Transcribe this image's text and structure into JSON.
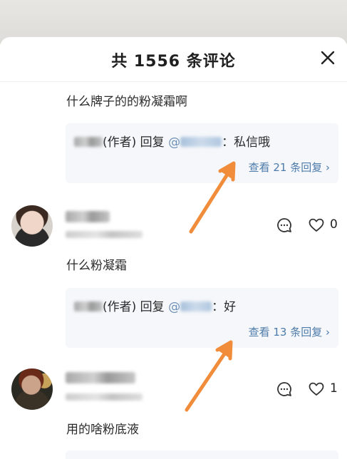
{
  "header": {
    "title": "共 1556 条评论"
  },
  "comments": [
    {
      "text": "什么牌子的的粉凝霜啊",
      "reply": {
        "tag": "(作者)",
        "verb": " 回复 ",
        "at": "@",
        "content": "：私信哦",
        "more": "查看 21 条回复 ›"
      }
    },
    {
      "likes": "0",
      "text": "什么粉凝霜",
      "reply": {
        "tag": "(作者)",
        "verb": " 回复 ",
        "at": "@",
        "content": "：好",
        "more": "查看 13 条回复 ›"
      }
    },
    {
      "likes": "1",
      "text": "用的啥粉底液"
    }
  ],
  "icons": {
    "close": "close-icon",
    "comment": "comment-bubble-icon",
    "like": "heart-icon"
  },
  "colors": {
    "link": "#4d7bab",
    "arrow": "#f08c3a",
    "card_bg": "#f5f7fa"
  }
}
